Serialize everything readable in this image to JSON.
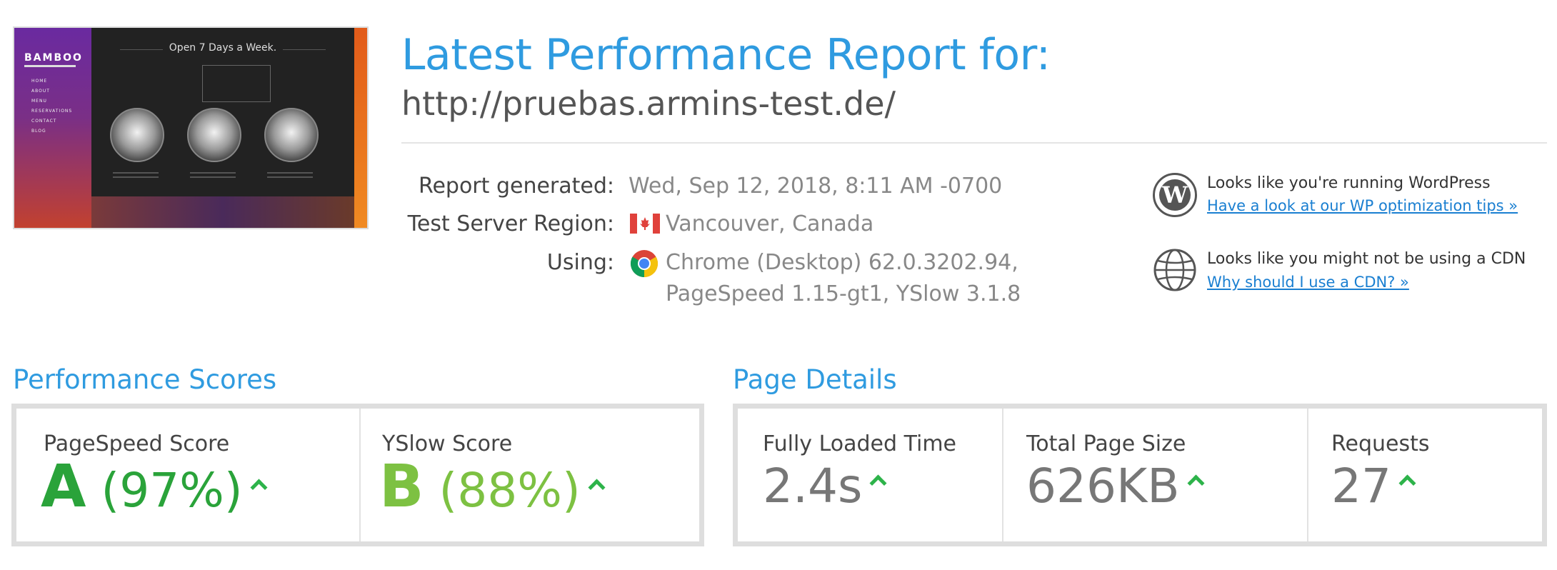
{
  "thumbnail": {
    "logo": "BAMBOO",
    "nav": [
      "HOME",
      "ABOUT",
      "MENU",
      "RESERVATIONS",
      "CONTACT",
      "BLOG"
    ],
    "heading": "Open 7 Days a Week."
  },
  "header": {
    "title": "Latest Performance Report for:",
    "url": "http://pruebas.armins-test.de/"
  },
  "report": {
    "generated_label": "Report generated:",
    "generated_value": "Wed, Sep 12, 2018, 8:11 AM -0700",
    "region_label": "Test Server Region:",
    "region_value": "Vancouver, Canada",
    "using_label": "Using:",
    "using_line1": "Chrome (Desktop) 62.0.3202.94,",
    "using_line2": "PageSpeed 1.15-gt1, YSlow 3.1.8"
  },
  "notes": {
    "wordpress_text": "Looks like you're running WordPress",
    "wordpress_link": "Have a look at our WP optimization tips »",
    "cdn_text": "Looks like you might not be using a CDN",
    "cdn_link": "Why should I use a CDN? »"
  },
  "performance": {
    "title": "Performance Scores",
    "pagespeed_label": "PageSpeed Score",
    "pagespeed_grade": "A",
    "pagespeed_pct": "(97%)",
    "yslow_label": "YSlow Score",
    "yslow_grade": "B",
    "yslow_pct": "(88%)"
  },
  "details": {
    "title": "Page Details",
    "loaded_label": "Fully Loaded Time",
    "loaded_value": "2.4s",
    "size_label": "Total Page Size",
    "size_value": "626KB",
    "requests_label": "Requests",
    "requests_value": "27"
  },
  "colors": {
    "accent": "#2f9be0",
    "grade_a": "#2aa33a",
    "grade_b": "#7dc142",
    "arrow": "#2db34a",
    "link": "#1a7fd1"
  },
  "icons": [
    "wordpress-icon",
    "globe-icon",
    "canada-flag-icon",
    "chrome-icon",
    "arrow-up-icon"
  ]
}
